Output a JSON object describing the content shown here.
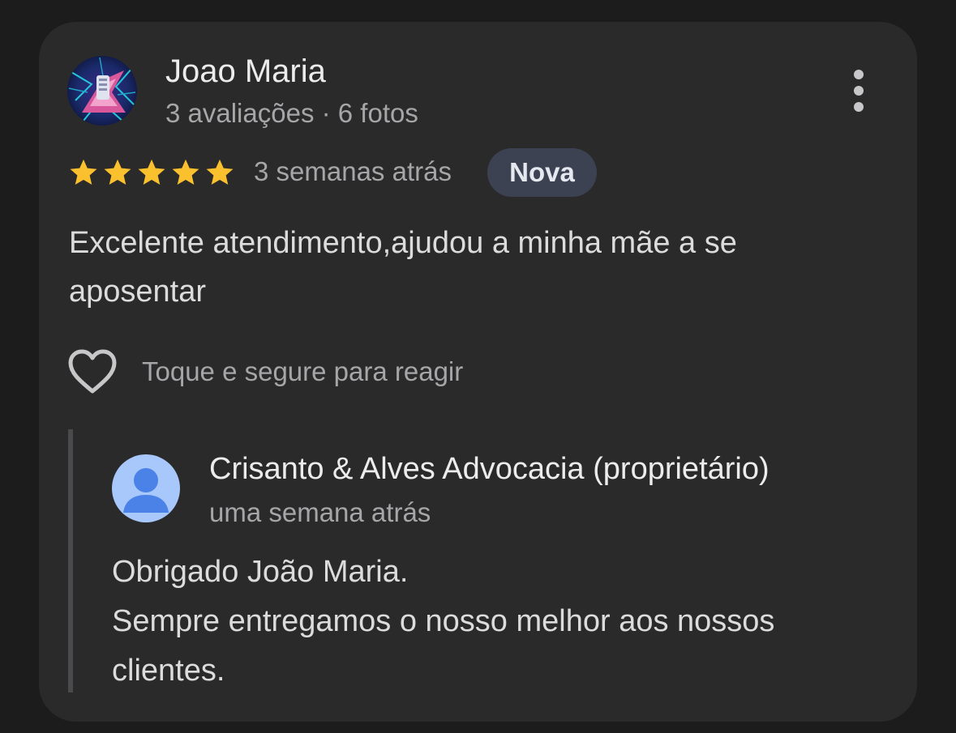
{
  "review": {
    "author": "Joao Maria",
    "author_meta": "3 avaliações · 6 fotos",
    "rating": 5,
    "max_rating": 5,
    "time_ago": "3 semanas atrás",
    "badge": "Nova",
    "text": "Excelente atendimento,ajudou a minha mãe a se aposentar",
    "react_hint": "Toque e segure para reagir",
    "icons": {
      "avatar": "profile-photo",
      "more": "more-vertical-icon",
      "star": "star-icon",
      "react": "heart-outline-icon"
    }
  },
  "reply": {
    "owner": "Crisanto & Alves Advocacia (proprietário)",
    "time_ago": "uma semana atrás",
    "lines": [
      "Obrigado João Maria.",
      "Sempre entregamos o nosso melhor aos nossos clientes."
    ],
    "icons": {
      "avatar": "default-person-avatar-icon"
    }
  },
  "colors": {
    "background": "#1c1c1d",
    "card": "#2a2a2b",
    "star": "#fbc02d",
    "badge_bg": "#3d4252",
    "owner_avatar_bg": "#a8c7fa",
    "owner_avatar_fg": "#4a82e8"
  }
}
